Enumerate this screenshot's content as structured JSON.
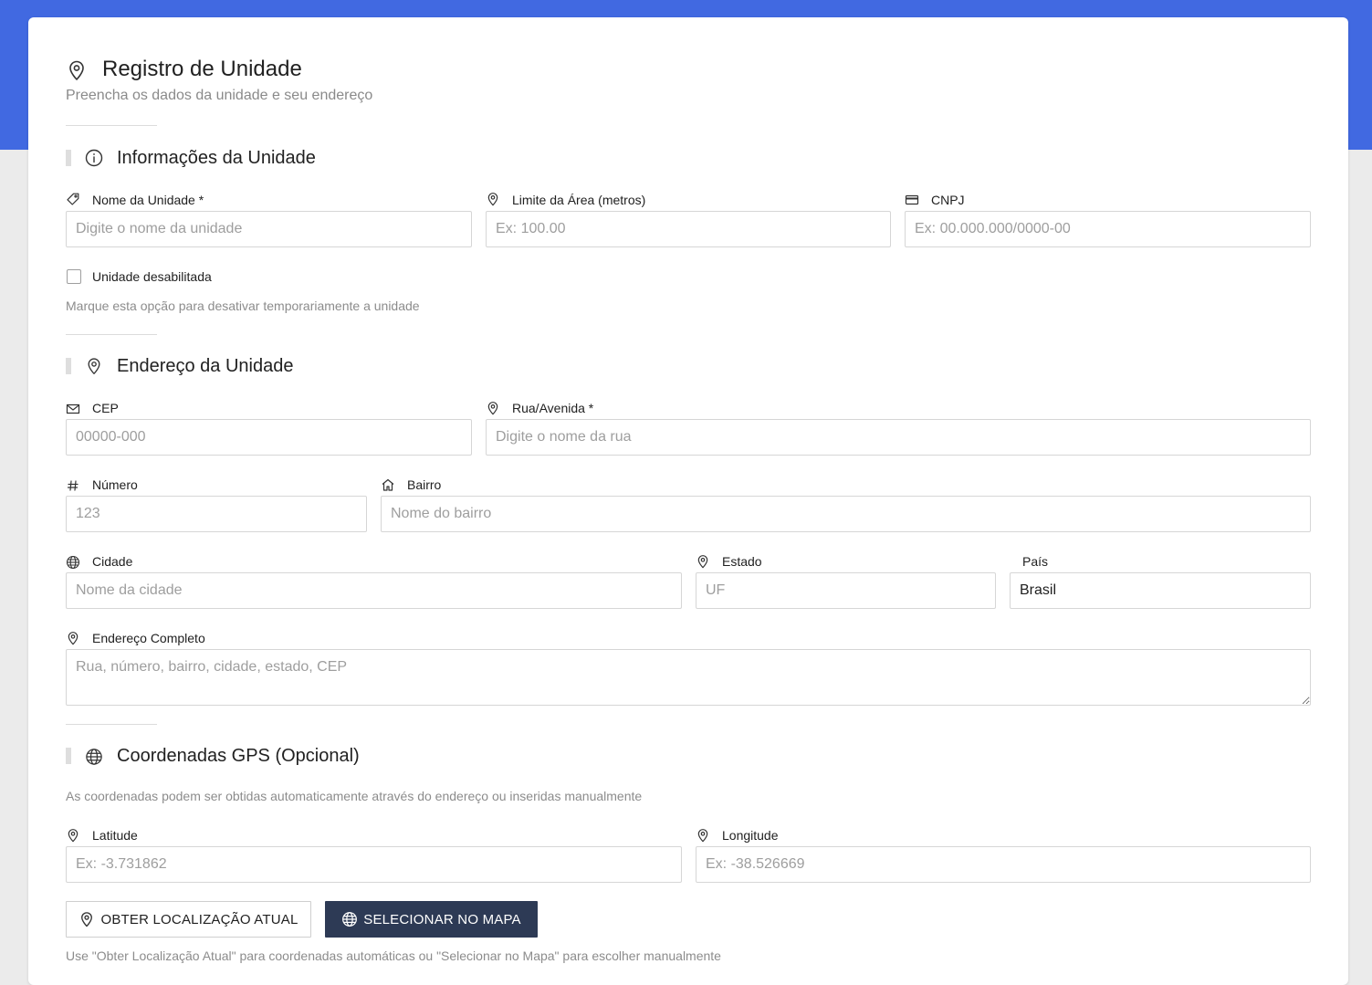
{
  "header": {
    "title": "Registro de Unidade",
    "subtitle": "Preencha os dados da unidade e seu endereço"
  },
  "sections": {
    "info": {
      "title": "Informações da Unidade"
    },
    "address": {
      "title": "Endereço da Unidade"
    },
    "gps": {
      "title": "Coordenadas GPS (Opcional)",
      "description": "As coordenadas podem ser obtidas automaticamente através do endereço ou inseridas manualmente"
    }
  },
  "fields": {
    "unit_name": {
      "label": "Nome da Unidade *",
      "placeholder": "Digite o nome da unidade"
    },
    "area_limit": {
      "label": "Limite da Área (metros)",
      "placeholder": "Ex: 100.00"
    },
    "cnpj": {
      "label": "CNPJ",
      "placeholder": "Ex: 00.000.000/0000-00"
    },
    "disabled": {
      "label": "Unidade desabilitada",
      "hint": "Marque esta opção para desativar temporariamente a unidade"
    },
    "cep": {
      "label": "CEP",
      "placeholder": "00000-000"
    },
    "street": {
      "label": "Rua/Avenida *",
      "placeholder": "Digite o nome da rua"
    },
    "number": {
      "label": "Número",
      "placeholder": "123"
    },
    "neighborhood": {
      "label": "Bairro",
      "placeholder": "Nome do bairro"
    },
    "city": {
      "label": "Cidade",
      "placeholder": "Nome da cidade"
    },
    "state": {
      "label": "Estado",
      "placeholder": "UF"
    },
    "country": {
      "label": "País",
      "value": "Brasil"
    },
    "full_address": {
      "label": "Endereço Completo",
      "placeholder": "Rua, número, bairro, cidade, estado, CEP"
    },
    "latitude": {
      "label": "Latitude",
      "placeholder": "Ex: -3.731862"
    },
    "longitude": {
      "label": "Longitude",
      "placeholder": "Ex: -38.526669"
    }
  },
  "buttons": {
    "current_location": "OBTER LOCALIZAÇÃO ATUAL",
    "select_map": "SELECIONAR NO MAPA"
  },
  "footer_hint": "Use \"Obter Localização Atual\" para coordenadas automáticas ou \"Selecionar no Mapa\" para escolher manualmente",
  "icons": {
    "title": "map-pin-icon",
    "info_section": "info-circle-icon",
    "address_section": "map-pin-icon",
    "gps_section": "globe-icon",
    "unit_name": "tag-icon",
    "area_limit": "map-pin-icon",
    "cnpj": "credit-card-icon",
    "cep": "mail-icon",
    "street": "map-pin-icon",
    "number": "hash-icon",
    "neighborhood": "home-icon",
    "city": "globe-icon",
    "state": "map-pin-icon",
    "full_address": "map-pin-icon",
    "latitude": "map-pin-icon",
    "longitude": "map-pin-icon"
  },
  "colors": {
    "banner": "#4169e1",
    "dark_button": "#2d3a55",
    "background": "#ebebeb"
  }
}
